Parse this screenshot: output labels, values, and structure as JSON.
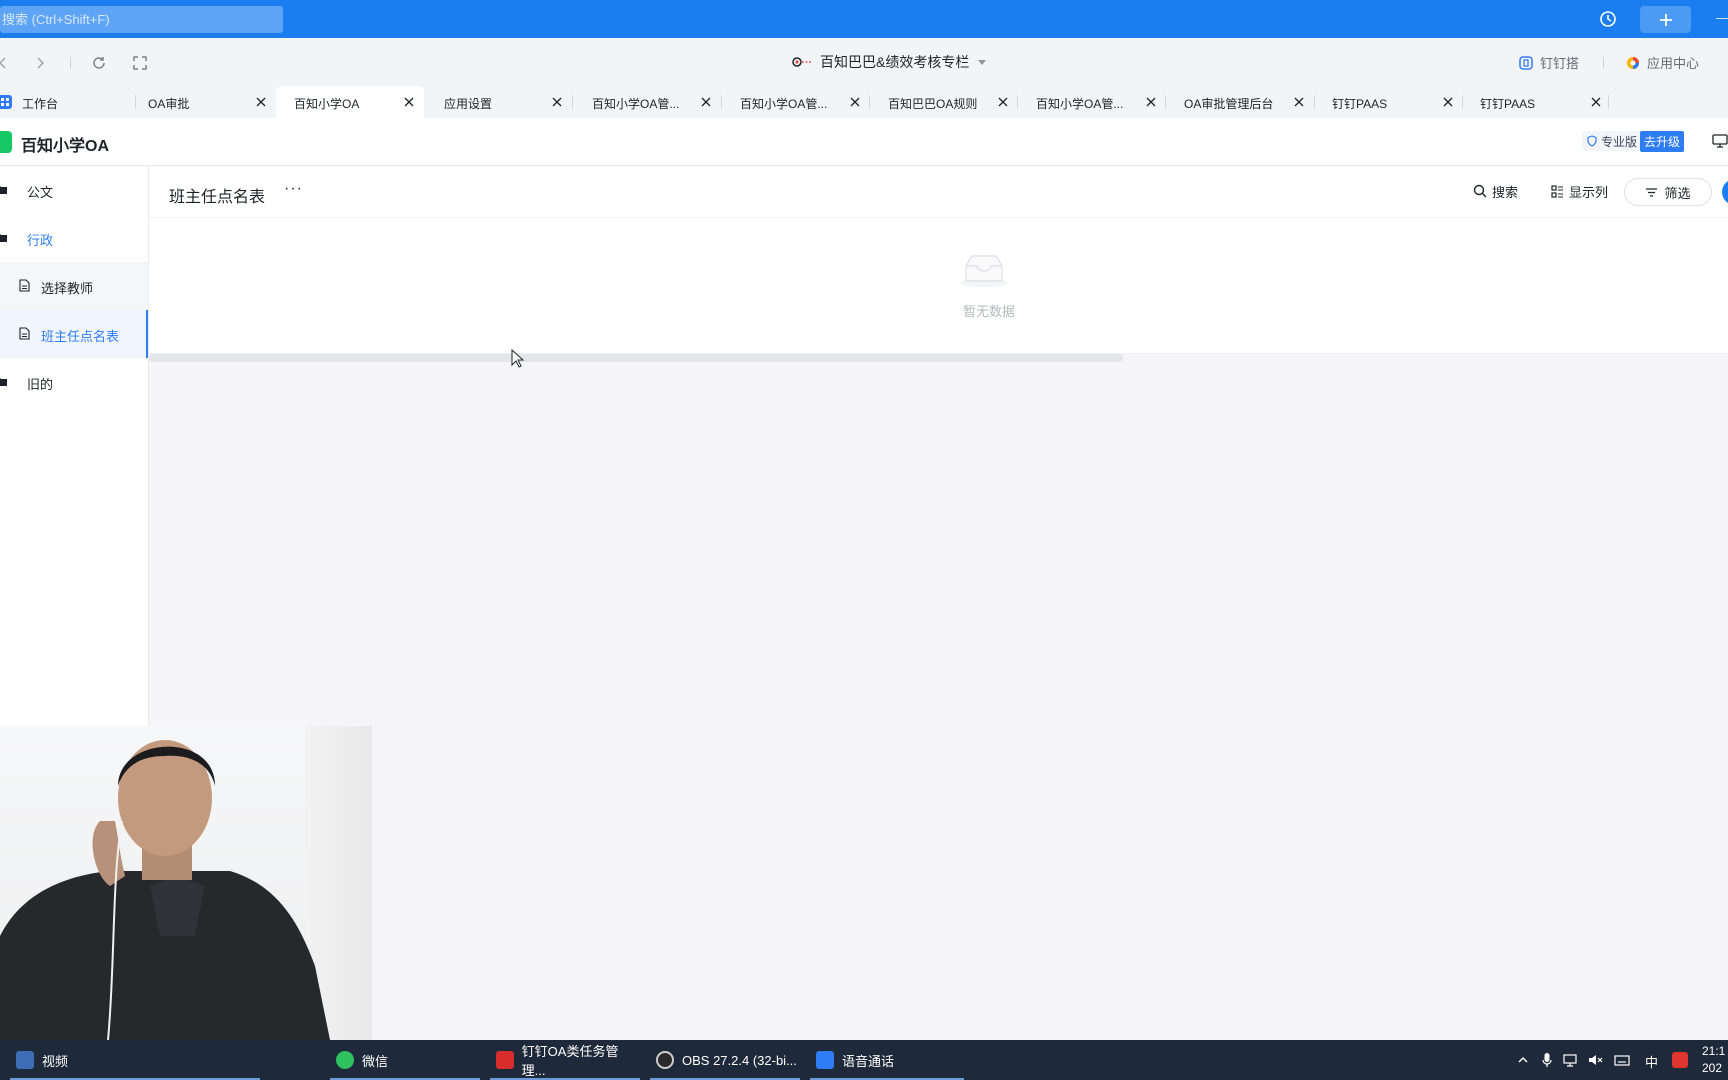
{
  "topbar": {
    "search_placeholder": "搜索 (Ctrl+Shift+F)"
  },
  "nav": {
    "doc_title": "百知巴巴&绩效考核专栏",
    "dingda": "钉钉搭",
    "app_center": "应用中心"
  },
  "tabs": [
    {
      "label": "工作台"
    },
    {
      "label": "OA审批"
    },
    {
      "label": "百知小学OA"
    },
    {
      "label": "应用设置"
    },
    {
      "label": "百知小学OA管..."
    },
    {
      "label": "百知小学OA管..."
    },
    {
      "label": "百知巴巴OA规则"
    },
    {
      "label": "百知小学OA管..."
    },
    {
      "label": "OA审批管理后台"
    },
    {
      "label": "钉钉PAAS"
    },
    {
      "label": "钉钉PAAS"
    }
  ],
  "app": {
    "title": "百知小学OA",
    "edition": "专业版",
    "upgrade": "去升级"
  },
  "sidebar": {
    "items": [
      {
        "label": "公文"
      },
      {
        "label": "行政"
      },
      {
        "label": "选择教师"
      },
      {
        "label": "班主任点名表"
      },
      {
        "label": "旧的"
      }
    ]
  },
  "main": {
    "title": "班主任点名表",
    "more": "···",
    "search": "搜索",
    "columns": "显示列",
    "filter": "筛选",
    "empty_text": "暂无数据"
  },
  "taskbar": {
    "items": [
      {
        "label": "视频"
      },
      {
        "label": "微信"
      },
      {
        "label": "钉钉OA类任务管理..."
      },
      {
        "label": "OBS 27.2.4 (32-bi..."
      },
      {
        "label": "语音通话"
      }
    ],
    "ime": "中",
    "time": "21:1",
    "date": "202"
  },
  "colors": {
    "brand_blue": "#1a7ef0",
    "accent": "#2e7cf6",
    "taskbar": "#1e2a3a"
  }
}
